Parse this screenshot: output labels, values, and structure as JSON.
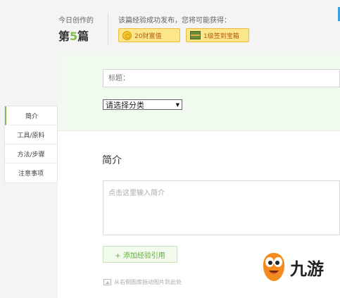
{
  "header": {
    "today_label": "今日创作的",
    "count_prefix": "第",
    "count_number": "5",
    "count_suffix": "篇",
    "reward_label": "该篇经验成功发布，您将可能获得：",
    "badges": [
      {
        "label": "20财富值",
        "icon": "coin-icon"
      },
      {
        "label": "1级签到宝箱",
        "icon": "treasure-chest-icon"
      }
    ]
  },
  "form": {
    "title_placeholder": "标题：",
    "category_select": "请选择分类"
  },
  "nav": {
    "items": [
      {
        "label": "简介"
      },
      {
        "label": "工具/原料"
      },
      {
        "label": "方法/步骤"
      },
      {
        "label": "注意事项"
      }
    ]
  },
  "intro": {
    "heading": "简介",
    "placeholder": "点击这里输入简介",
    "add_reference": "+ 添加经验引用",
    "drag_hint": "从右侧图库拖动图片到此处"
  },
  "watermark": {
    "text": "九游"
  },
  "colors": {
    "accent_green": "#7cbf4a",
    "badge_yellow": "#fce68a",
    "mascot_orange": "#f28a1e"
  }
}
